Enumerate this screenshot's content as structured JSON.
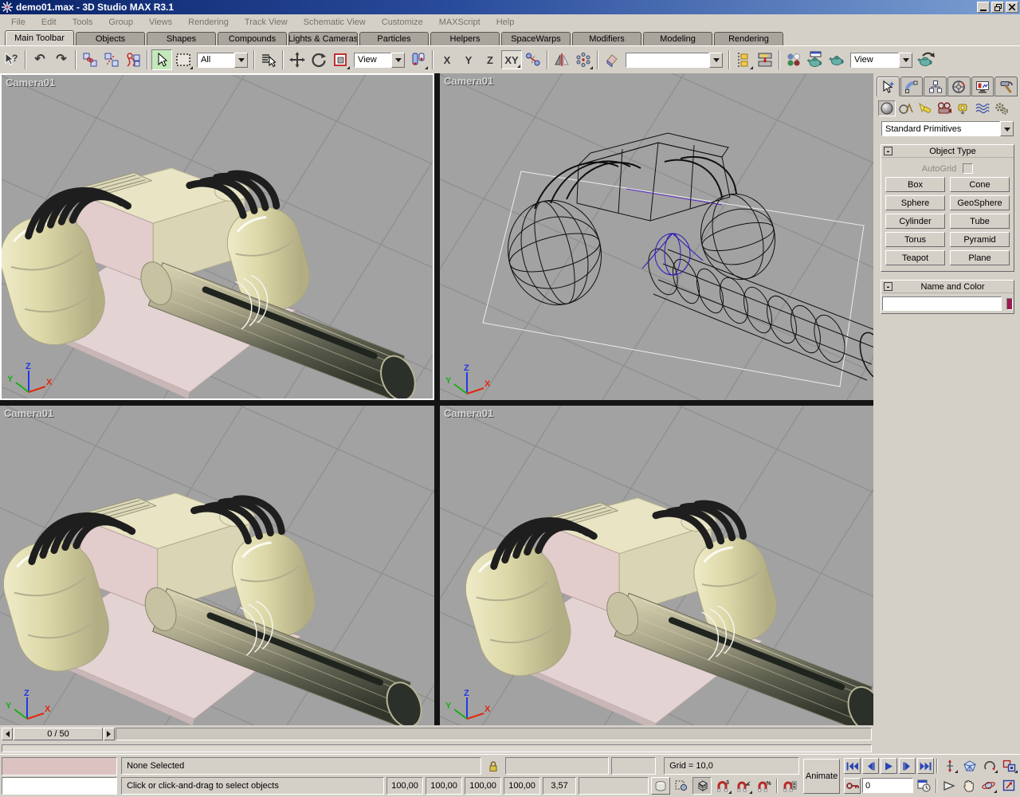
{
  "window": {
    "title": "demo01.max - 3D Studio MAX R3.1"
  },
  "menu": {
    "items": [
      "File",
      "Edit",
      "Tools",
      "Group",
      "Views",
      "Rendering",
      "Track View",
      "Schematic View",
      "Customize",
      "MAXScript",
      "Help"
    ]
  },
  "tabs": {
    "items": [
      "Main Toolbar",
      "Objects",
      "Shapes",
      "Compounds",
      "Lights & Cameras",
      "Particles",
      "Helpers",
      "SpaceWarps",
      "Modifiers",
      "Modeling",
      "Rendering"
    ],
    "active": "Main Toolbar"
  },
  "toolbar": {
    "selection_filter_value": "All",
    "coordsys_value": "View",
    "render_type_value": "View",
    "named_selection_value": "",
    "axis_x": "X",
    "axis_y": "Y",
    "axis_z": "Z",
    "axis_xy": "XY"
  },
  "icons": {
    "help_question": "?",
    "undo": "↶",
    "redo": "↷"
  },
  "viewports": {
    "top_left": {
      "label": "Camera01"
    },
    "top_right": {
      "label": "Camera01"
    },
    "bottom_left": {
      "label": "Camera01"
    },
    "bottom_right": {
      "label": "Camera01"
    },
    "axis": {
      "x": "X",
      "y": "Y",
      "z": "Z"
    }
  },
  "command_panel": {
    "category_dropdown": "Standard Primitives",
    "object_type": {
      "collapse": "-",
      "title": "Object Type",
      "autogrid_label": "AutoGrid",
      "buttons": [
        "Box",
        "Cone",
        "Sphere",
        "GeoSphere",
        "Cylinder",
        "Tube",
        "Torus",
        "Pyramid",
        "Teapot",
        "Plane"
      ]
    },
    "name_and_color": {
      "collapse": "-",
      "title": "Name and Color",
      "name_value": "",
      "swatch_color": "#9c1a50"
    }
  },
  "timeline": {
    "slider_label": "0 / 50"
  },
  "status_bar": {
    "selection_status": "None Selected",
    "prompt": "Click or click-and-drag to select objects",
    "coords": [
      "100,00",
      "100,00",
      "100,00",
      "100,00",
      "3,57"
    ],
    "grid_label": "Grid = 10,0",
    "animate_label": "Animate",
    "current_frame": "0"
  }
}
